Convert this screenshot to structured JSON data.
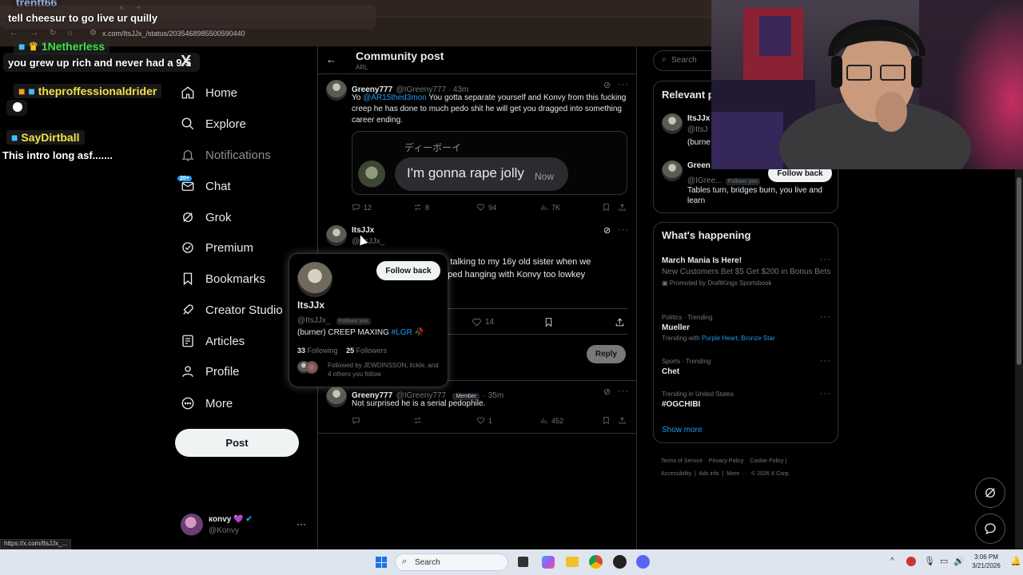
{
  "browser": {
    "tab_hint": "...",
    "url": "x.com/ItsJJx_/status/2035468985500590440",
    "status_url": "https://x.com/ItsJJx_..."
  },
  "chat": {
    "line1_user": "trentt66",
    "line1_msg": "tell cheesur to go live ur quilly",
    "line2_user": "1Netherless",
    "line2_msg": "you grew up rich and never had a 9-5",
    "line3_user": "theproffessionaldrider",
    "line4_user": "SayDirtball",
    "line4_msg": "This intro long asf......."
  },
  "nav": {
    "logo": "X",
    "items": [
      {
        "label": "Home",
        "icon": "home-icon"
      },
      {
        "label": "Explore",
        "icon": "search-icon"
      },
      {
        "label": "Notifications",
        "icon": "bell-icon"
      },
      {
        "label": "Chat",
        "icon": "mail-icon",
        "badge": "20+"
      },
      {
        "label": "Grok",
        "icon": "grok-icon"
      },
      {
        "label": "Premium",
        "icon": "premium-icon"
      },
      {
        "label": "Bookmarks",
        "icon": "bookmark-icon"
      },
      {
        "label": "Creator Studio",
        "icon": "rocket-icon"
      },
      {
        "label": "Articles",
        "icon": "article-icon"
      },
      {
        "label": "Profile",
        "icon": "person-icon"
      },
      {
        "label": "More",
        "icon": "more-icon"
      }
    ],
    "post_label": "Post",
    "account_name": "кonvy 💜",
    "account_handle": "@Konvy",
    "account_more": "···"
  },
  "header": {
    "title": "Community post",
    "subtitle": "ARL"
  },
  "tweet1": {
    "name": "Greeny777",
    "handle": "@IGreeny777 · 43m",
    "text_prefix": "Yo ",
    "mention": "@AR15thed3mon",
    "text": " You gotta separate yourself and Konvy from this fucking creep he has done to much pedo shit he will get you dragged into something career ending.",
    "embed_name": "ディーボーイ",
    "embed_message": "I'm gonna rape jolly",
    "embed_time": "Now",
    "replies": "12",
    "reposts": "8",
    "likes": "94",
    "views": "7K"
  },
  "tweet2": {
    "name": "ItsJJx",
    "handle": "@ItsJJx_",
    "text_line1": "ed talking to my 16y old sister when we",
    "text_line2": "opped hanging with Konvy too lowkey",
    "text_line3": "s",
    "likes": "14",
    "reply_label": "Reply"
  },
  "tweet3": {
    "name": "Greeny777",
    "handle": "@IGreeny777",
    "member_badge": "Member",
    "time": "· 35m",
    "text": "Not surprised he is a serial pedophile.",
    "likes": "1",
    "views": "452"
  },
  "hovercard": {
    "name": "ItsJJx",
    "handle": "@ItsJJx_",
    "follows_you": "Follows you",
    "follow_back": "Follow back",
    "bio_prefix": "(burner) CREEP MAXING ",
    "bio_tag": "#LGR",
    "bio_emoji": "🥀",
    "following_count": "33",
    "following_label": "Following",
    "followers_count": "25",
    "followers_label": "Followers",
    "followed_by": "Followed by JEWDINSSON, tickle, and 4 others you follow"
  },
  "right": {
    "search_placeholder": "Search",
    "relevant_title": "Relevant p",
    "rel1_name": "ItsJJx",
    "rel1_handle": "@ItsJ",
    "rel1_bio": "(burne",
    "rel2_name": "Green",
    "rel2_handle": "@IGree...",
    "rel2_follows": "Follows you",
    "rel2_follow_back": "Follow back",
    "rel2_bio": "Tables turn, bridges burn, you live and learn",
    "happening_title": "What's happening",
    "trends": [
      {
        "meta": "",
        "title": "March Mania Is Here!",
        "desc": "New Customers Bet $5 Get $200 in Bonus Bets",
        "extra": "Promoted by DraftKings Sportsbook"
      },
      {
        "meta": "Politics · Trending",
        "title": "Mueller",
        "desc": "Trending with ",
        "extra": "Purple Heart, Bronze Star"
      },
      {
        "meta": "Sports · Trending",
        "title": "Chet",
        "desc": "",
        "extra": ""
      },
      {
        "meta": "Trending in United States",
        "title": "#OGCHIBI",
        "desc": "",
        "extra": ""
      }
    ],
    "show_more": "Show more",
    "footer": [
      "Terms of Service",
      "|",
      "Privacy Policy",
      "|",
      "Cookie Policy",
      "|",
      "Accessibility",
      "|",
      "Ads info",
      "|",
      "More ···",
      "© 2026 X Corp."
    ]
  },
  "taskbar": {
    "search": "Search",
    "time": "3:06 PM",
    "date": "3/21/2026"
  }
}
